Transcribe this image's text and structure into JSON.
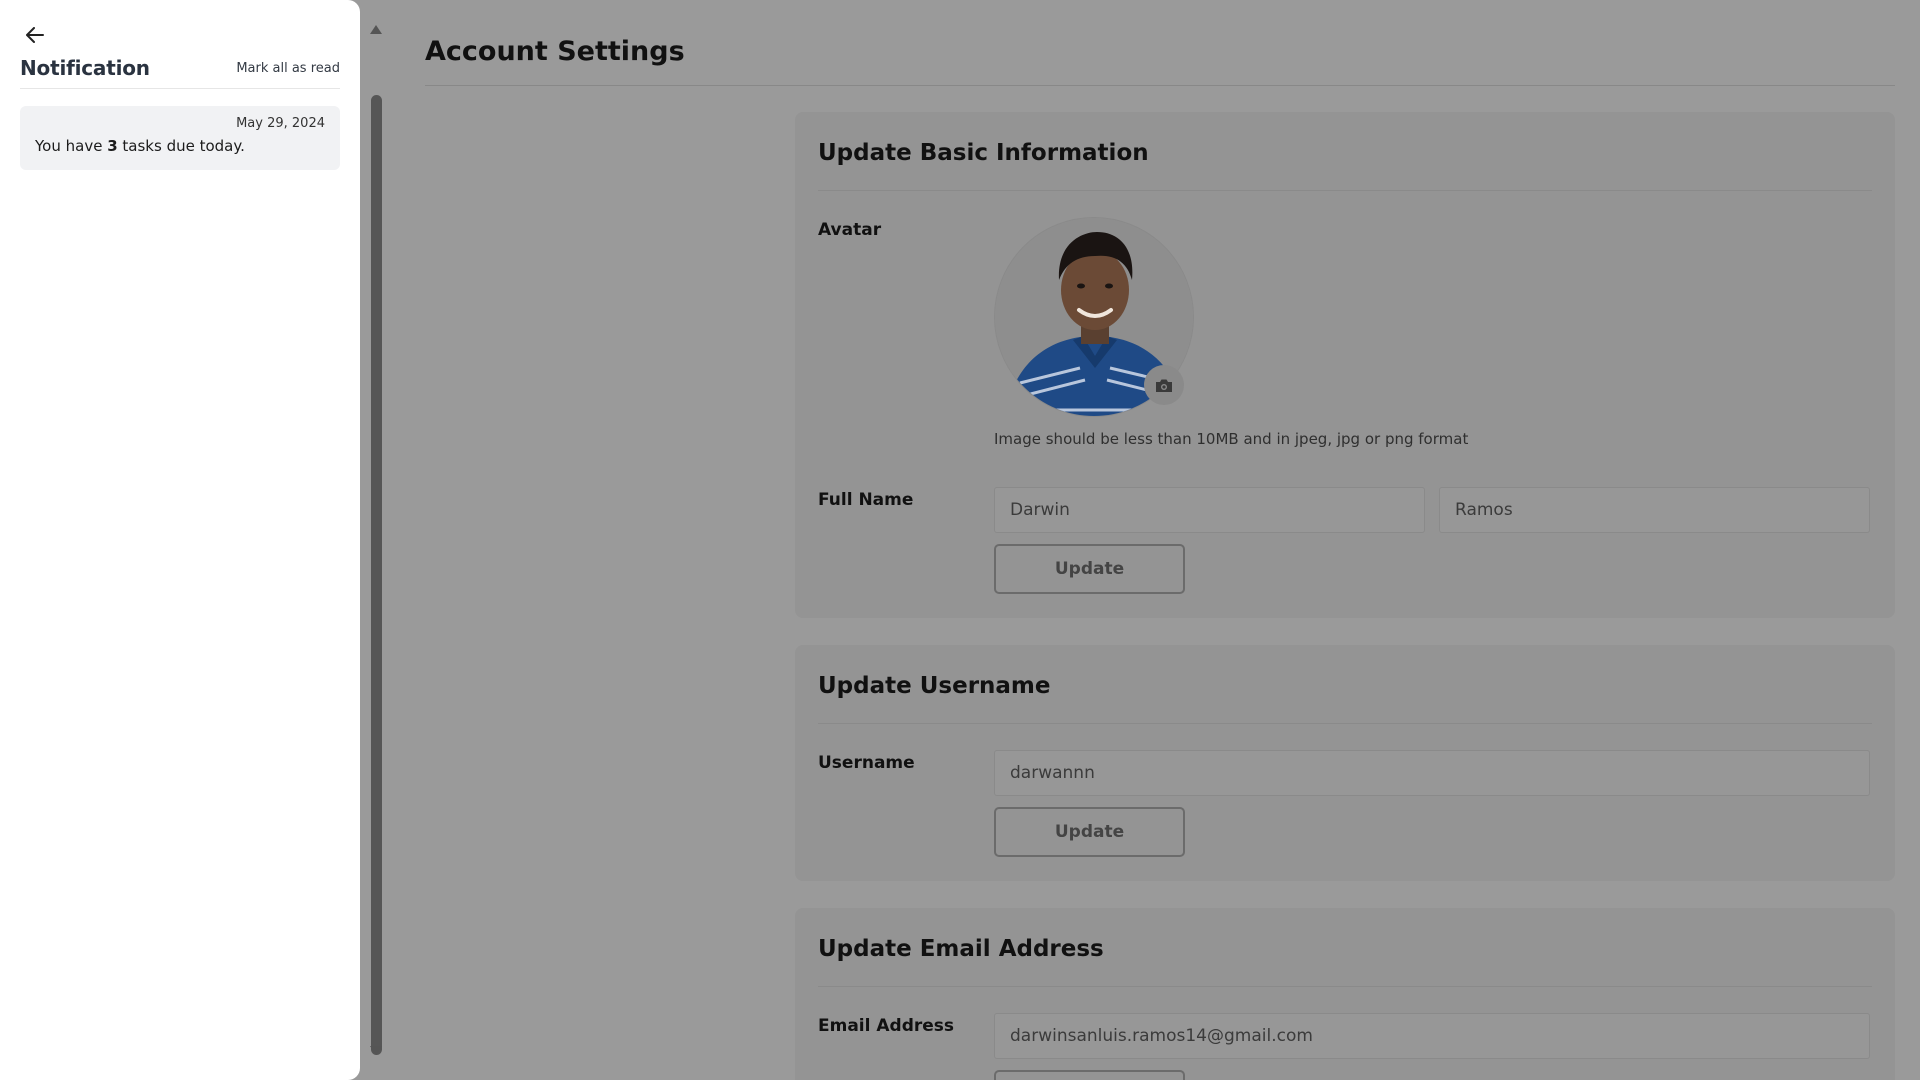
{
  "notification_panel": {
    "title": "Notification",
    "mark_all_label": "Mark all as read",
    "items": [
      {
        "date": "May 29, 2024",
        "message_prefix": "You have ",
        "count": "3",
        "message_suffix": " tasks due today."
      }
    ]
  },
  "page": {
    "title": "Account Settings"
  },
  "basic_info": {
    "title": "Update Basic Information",
    "avatar_label": "Avatar",
    "avatar_hint": "Image should be less than 10MB and in jpeg, jpg or png format",
    "full_name_label": "Full Name",
    "first_name": "Darwin",
    "last_name": "Ramos",
    "update_label": "Update"
  },
  "username_section": {
    "title": "Update Username",
    "label": "Username",
    "value": "darwannn",
    "update_label": "Update"
  },
  "email_section": {
    "title": "Update Email Address",
    "label": "Email Address",
    "value": "darwinsanluis.ramos14@gmail.com"
  },
  "icons": {
    "back": "arrow-left-icon",
    "camera": "camera-icon",
    "scroll_up": "scroll-up-arrow",
    "scroll_down": "scroll-down-arrow"
  },
  "colors": {
    "overlay": "#9a9a9a",
    "panel": "#ffffff",
    "notification_item": "#f1f2f4",
    "card": "#949494"
  }
}
